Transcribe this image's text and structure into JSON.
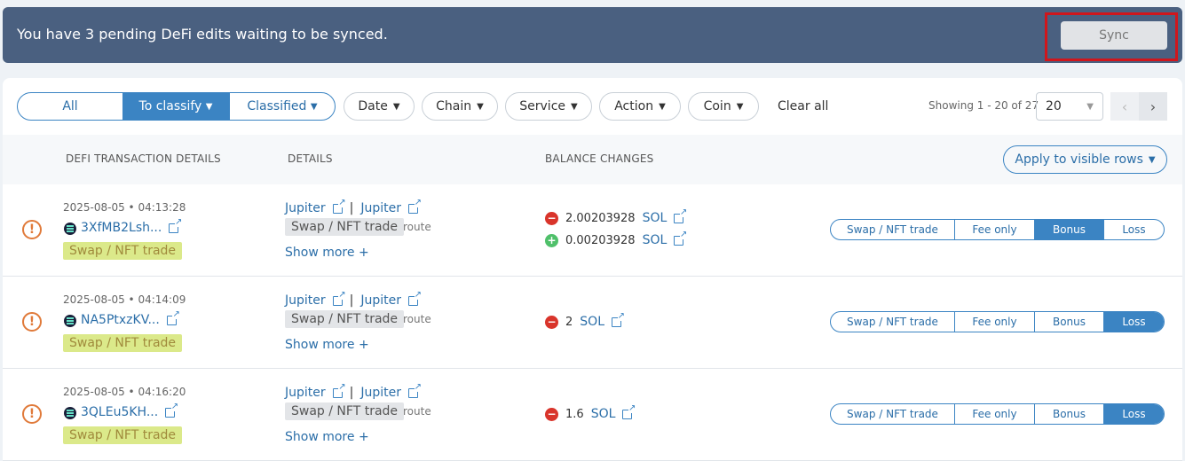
{
  "banner": {
    "message": "You have 3 pending DeFi edits waiting to be synced.",
    "sync_label": "Sync"
  },
  "filters": {
    "segments": [
      "All",
      "To classify",
      "Classified"
    ],
    "active_segment": "To classify",
    "pills": [
      "Date",
      "Chain",
      "Service",
      "Action",
      "Coin"
    ],
    "clear_all": "Clear all",
    "showing": "Showing 1 - 20 of 27",
    "per_page": "20"
  },
  "table": {
    "headers": [
      "DEFI TRANSACTION DETAILS",
      "DETAILS",
      "BALANCE CHANGES"
    ],
    "apply_label": "Apply to visible rows",
    "classify_options": [
      "Swap / NFT trade",
      "Fee only",
      "Bonus",
      "Loss"
    ],
    "rows": [
      {
        "date": "2025-08-05 • 04:13:28",
        "hash": "3XfMB2Lsh...",
        "tag": "Swap / NFT trade",
        "service_a": "Jupiter",
        "service_b": "Jupiter",
        "type": "Swap / NFT trade",
        "route": "route",
        "show_more": "Show more",
        "balances": [
          {
            "sign": "minus",
            "amount": "2.00203928",
            "symbol": "SOL"
          },
          {
            "sign": "plus",
            "amount": "0.00203928",
            "symbol": "SOL"
          }
        ],
        "active": "Bonus"
      },
      {
        "date": "2025-08-05 • 04:14:09",
        "hash": "NA5PtxzKV...",
        "tag": "Swap / NFT trade",
        "service_a": "Jupiter",
        "service_b": "Jupiter",
        "type": "Swap / NFT trade",
        "route": "route",
        "show_more": "Show more",
        "balances": [
          {
            "sign": "minus",
            "amount": "2",
            "symbol": "SOL"
          }
        ],
        "active": "Loss"
      },
      {
        "date": "2025-08-05 • 04:16:20",
        "hash": "3QLEu5KH...",
        "tag": "Swap / NFT trade",
        "service_a": "Jupiter",
        "service_b": "Jupiter",
        "type": "Swap / NFT trade",
        "route": "route",
        "show_more": "Show more",
        "balances": [
          {
            "sign": "minus",
            "amount": "1.6",
            "symbol": "SOL"
          }
        ],
        "active": "Loss"
      }
    ]
  },
  "colors": {
    "banner": "#4a6080",
    "accent": "#3b84c3",
    "highlight": "#d0161c",
    "tag_yellow": "#dbe98a",
    "minus": "#d9342b",
    "plus": "#4fc06a"
  }
}
